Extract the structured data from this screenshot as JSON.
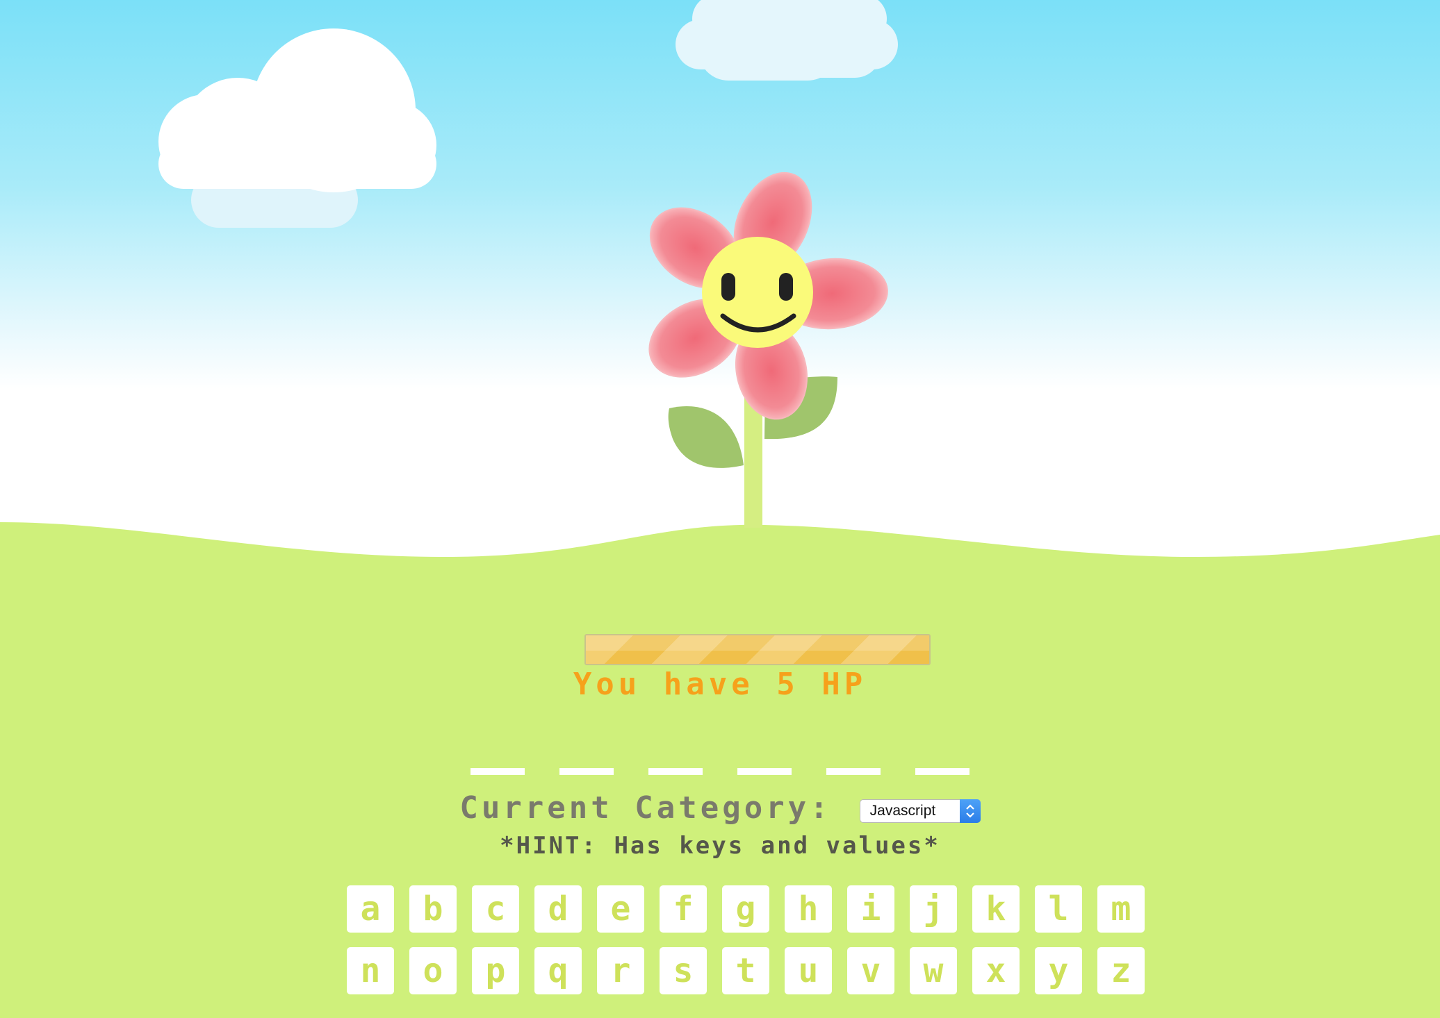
{
  "game": {
    "hp_text": "You have 5 HP",
    "hp_level_fraction": 1.0,
    "word_blank_count": 6,
    "category_label": "Current Category:",
    "category_selected": "Javascript",
    "hint": "*HINT: Has keys and values*"
  },
  "keyboard": {
    "row1": [
      "a",
      "b",
      "c",
      "d",
      "e",
      "f",
      "g",
      "h",
      "i",
      "j",
      "k",
      "l",
      "m"
    ],
    "row2": [
      "n",
      "o",
      "p",
      "q",
      "r",
      "s",
      "t",
      "u",
      "v",
      "w",
      "x",
      "y",
      "z"
    ]
  },
  "colors": {
    "sky_top": "#7be0f8",
    "ground": "#cff07b",
    "petal": "#f27a84",
    "face": "#fafa7a",
    "leaf": "#a0c56c",
    "stem": "#d5ee82",
    "hp_text": "#f6a11b",
    "key_letter": "#cee15a"
  },
  "icons": {
    "flower": "smiling-flower-icon",
    "cloud": "cloud-icon"
  }
}
